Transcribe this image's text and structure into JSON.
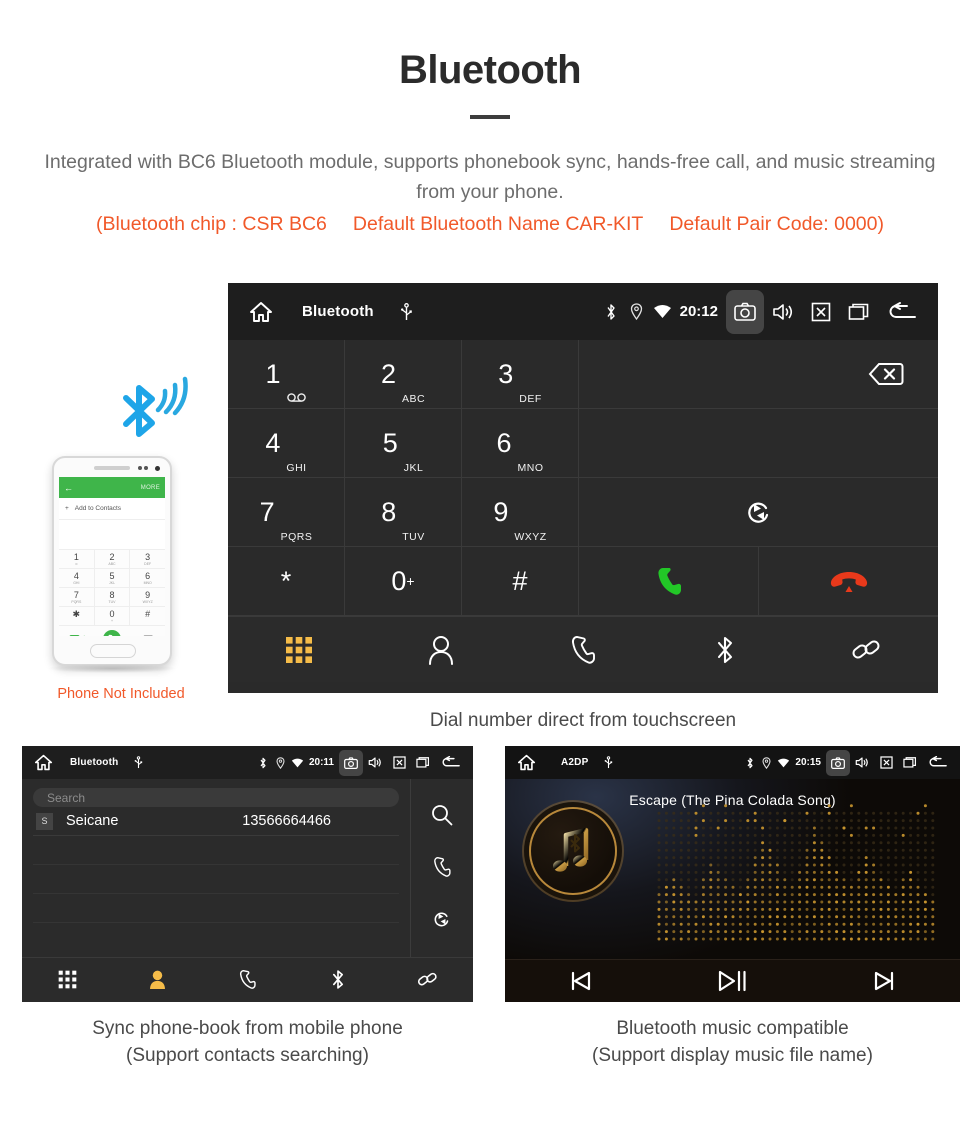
{
  "header": {
    "title": "Bluetooth",
    "description": "Integrated with BC6 Bluetooth module, supports phonebook sync, hands-free call, and music streaming from your phone.",
    "spec_chip": "(Bluetooth chip : CSR BC6",
    "spec_name": "Default Bluetooth Name CAR-KIT",
    "spec_pair": "Default Pair Code: 0000)",
    "accent_color": "#f1592a",
    "text_color": "#6d6d6d"
  },
  "dialer_panel": {
    "statusbar": {
      "home_icon": "home-icon",
      "title": "Bluetooth",
      "usb_icon": "usb-icon",
      "bluetooth_icon": "bluetooth-icon",
      "location_icon": "location-icon",
      "wifi_icon": "wifi-icon",
      "clock": "20:12",
      "camera_icon": "camera-icon",
      "volume_icon": "volume-icon",
      "close_icon": "close-box-icon",
      "windows_icon": "recent-apps-icon",
      "back_icon": "back-arrow-icon"
    },
    "keys": [
      {
        "digit": "1",
        "sub": "",
        "sub_icon": "voicemail-icon"
      },
      {
        "digit": "2",
        "sub": "ABC"
      },
      {
        "digit": "3",
        "sub": "DEF"
      },
      {
        "digit": "4",
        "sub": "GHI"
      },
      {
        "digit": "5",
        "sub": "JKL"
      },
      {
        "digit": "6",
        "sub": "MNO"
      },
      {
        "digit": "7",
        "sub": "PQRS"
      },
      {
        "digit": "8",
        "sub": "TUV"
      },
      {
        "digit": "9",
        "sub": "WXYZ"
      },
      {
        "digit": "*",
        "sub": ""
      },
      {
        "digit": "0",
        "sub": "+"
      },
      {
        "digit": "#",
        "sub": ""
      }
    ],
    "delete_icon": "backspace-icon",
    "redial_icon": "sync-redial-icon",
    "call_icon": "call-green-icon",
    "hangup_icon": "hangup-red-icon",
    "nav": [
      {
        "icon": "dialpad-icon",
        "active": true
      },
      {
        "icon": "contacts-icon",
        "active": false
      },
      {
        "icon": "call-log-icon",
        "active": false
      },
      {
        "icon": "bluetooth-icon",
        "active": false
      },
      {
        "icon": "link-icon",
        "active": false
      }
    ],
    "caption": "Dial number direct from touchscreen",
    "active_color": "#f5bc49"
  },
  "phone_mockup": {
    "bluetooth_icon": "bluetooth-signal-icon",
    "screen": {
      "back_icon": "back-arrow-icon",
      "more_label": "MORE",
      "add_label": "Add to Contacts",
      "keys": [
        {
          "digit": "1",
          "sub": "∞"
        },
        {
          "digit": "2",
          "sub": "ABC"
        },
        {
          "digit": "3",
          "sub": "DEF"
        },
        {
          "digit": "4",
          "sub": "GHI"
        },
        {
          "digit": "5",
          "sub": "JKL"
        },
        {
          "digit": "6",
          "sub": "MNO"
        },
        {
          "digit": "7",
          "sub": "PQRS"
        },
        {
          "digit": "8",
          "sub": "TUV"
        },
        {
          "digit": "9",
          "sub": "WXYZ"
        },
        {
          "digit": "✱",
          "sub": ""
        },
        {
          "digit": "0",
          "sub": "+"
        },
        {
          "digit": "#",
          "sub": ""
        }
      ],
      "video_call_icon": "video-call-icon",
      "call_icon": "call-icon",
      "backspace_icon": "backspace-icon"
    },
    "note": "Phone Not Included",
    "note_color": "#f1592a"
  },
  "phonebook_panel": {
    "statusbar": {
      "title": "Bluetooth",
      "clock": "20:11"
    },
    "search_placeholder": "Search",
    "contacts": [
      {
        "initial": "S",
        "name": "Seicane",
        "number": "13566664466"
      }
    ],
    "side_icons": [
      {
        "icon": "search-icon"
      },
      {
        "icon": "call-log-icon"
      },
      {
        "icon": "sync-icon"
      }
    ],
    "nav": [
      {
        "icon": "dialpad-icon",
        "active": false
      },
      {
        "icon": "contacts-icon",
        "active": true
      },
      {
        "icon": "call-log-icon",
        "active": false
      },
      {
        "icon": "bluetooth-icon",
        "active": false
      },
      {
        "icon": "link-icon",
        "active": false
      }
    ],
    "caption_line1": "Sync phone-book from mobile phone",
    "caption_line2": "(Support contacts searching)"
  },
  "music_panel": {
    "statusbar": {
      "title": "A2DP",
      "clock": "20:15"
    },
    "song_title": "Escape (The Pina Colada Song)",
    "album_icon": "music-note-bluetooth-icon",
    "visualizer": "dot-matrix-spectrum",
    "controls": [
      {
        "icon": "previous-track-icon"
      },
      {
        "icon": "play-pause-icon"
      },
      {
        "icon": "next-track-icon"
      }
    ],
    "caption_line1": "Bluetooth music compatible",
    "caption_line2": "(Support display music file name)",
    "accent_color": "#c9962f"
  }
}
